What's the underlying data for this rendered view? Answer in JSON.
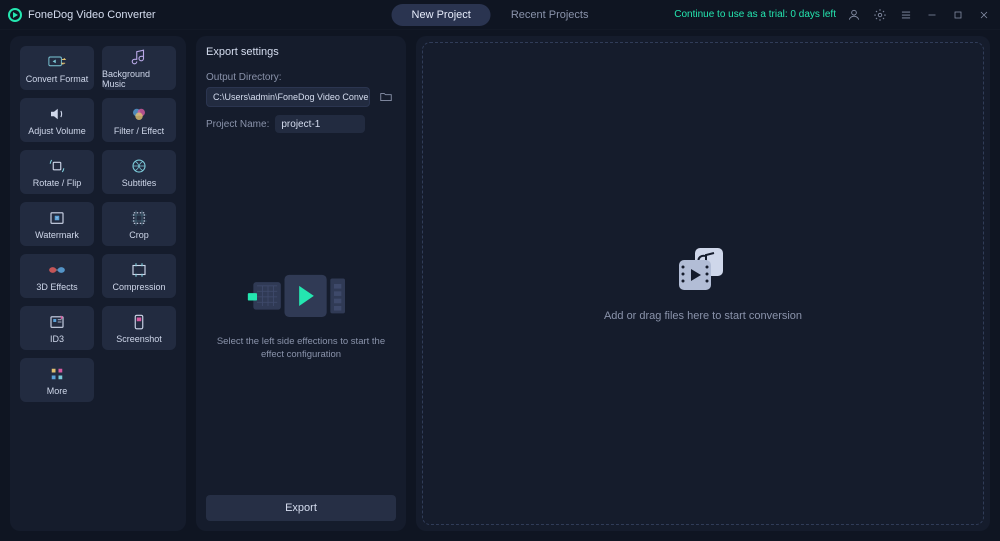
{
  "app": {
    "title": "FoneDog Video Converter"
  },
  "tabs": {
    "new": "New Project",
    "recent": "Recent Projects"
  },
  "trial": {
    "text": "Continue to use as a trial: 0 days left"
  },
  "tiles": {
    "convert": "Convert Format",
    "bgmusic": "Background Music",
    "volume": "Adjust Volume",
    "filter": "Filter / Effect",
    "rotate": "Rotate / Flip",
    "subtitles": "Subtitles",
    "watermark": "Watermark",
    "crop": "Crop",
    "threed": "3D Effects",
    "compress": "Compression",
    "id3": "ID3",
    "screenshot": "Screenshot",
    "more": "More"
  },
  "export": {
    "heading": "Export settings",
    "dir_label": "Output Directory:",
    "dir_value": "C:\\Users\\admin\\FoneDog Video Converter\\Converted",
    "name_label": "Project Name:",
    "name_value": "project-1",
    "hint": "Select the left side effections to start the effect configuration",
    "button": "Export"
  },
  "drop": {
    "msg": "Add or drag files here to start conversion"
  }
}
